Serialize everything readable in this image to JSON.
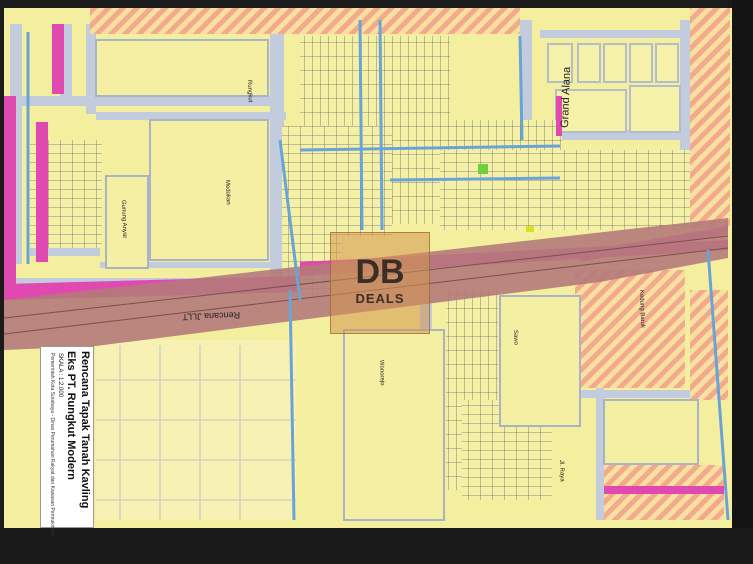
{
  "map": {
    "legend": {
      "title": "Rencana Tapak Tanah Kavling",
      "subtitle": "Eks PT. Rungkut Modern",
      "scale": "SKALA : 1:2.000",
      "notes": "Pemerintah Kota Surabaya - Dinas Perumahan Rakyat dan Kawasan Permukiman"
    },
    "labels": {
      "grand_alana": "Grand Alana",
      "road_label": "Rencana JLLT",
      "label_a": "Rungkut",
      "label_b": "Medokan",
      "label_c": "Gunung Anyar",
      "label_d": "Sawo",
      "label_e": "Kedung Baruk",
      "label_f": "Jl. Raya",
      "label_g": "Wonorejo"
    },
    "watermark": {
      "line1": "DB",
      "line2": "DEALS"
    },
    "colors": {
      "residential": "#f3ef9e",
      "road": "#bfc8d8",
      "river": "#7fb0dd",
      "primary_road": "#e04ab0",
      "corridor": "#b07878",
      "hatch": "#f4a98a"
    }
  }
}
